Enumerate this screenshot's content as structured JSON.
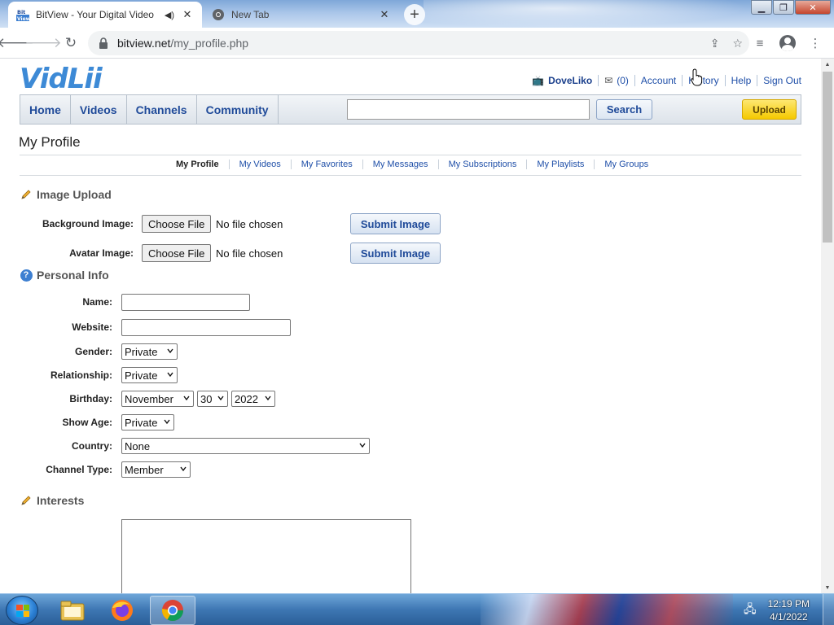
{
  "browser": {
    "tabs": [
      {
        "title": "BitView - Your Digital Video",
        "favicon": "bitview-favicon",
        "favicon_text": "Bit View",
        "active": true
      },
      {
        "title": "New Tab",
        "favicon": "chrome-icon",
        "active": false
      }
    ],
    "url_host": "bitview.net",
    "url_path": "/my_profile.php"
  },
  "site": {
    "logo_text": "VidLii",
    "user": {
      "username": "DoveLiko",
      "messages_count": "(0)",
      "links": [
        "Account",
        "History",
        "Help",
        "Sign Out"
      ]
    },
    "nav": [
      "Home",
      "Videos",
      "Channels",
      "Community"
    ],
    "search_placeholder": "",
    "search_label": "Search",
    "upload_label": "Upload",
    "colors": {
      "link": "#1f4fa8",
      "logo": "#5aa3e0",
      "upload": "#f5c900"
    }
  },
  "page": {
    "title": "My Profile",
    "subnav": [
      "My Profile",
      "My Videos",
      "My Favorites",
      "My Messages",
      "My Subscriptions",
      "My Playlists",
      "My Groups"
    ],
    "image_upload": {
      "heading": "Image Upload",
      "rows": [
        {
          "label": "Background Image:",
          "file_button": "Choose File",
          "file_status": "No file chosen",
          "submit": "Submit Image"
        },
        {
          "label": "Avatar Image:",
          "file_button": "Choose File",
          "file_status": "No file chosen",
          "submit": "Submit Image"
        }
      ]
    },
    "personal_info": {
      "heading": "Personal Info",
      "name_label": "Name:",
      "name_value": "",
      "website_label": "Website:",
      "website_value": "",
      "gender_label": "Gender:",
      "gender_value": "Private",
      "relationship_label": "Relationship:",
      "relationship_value": "Private",
      "birthday_label": "Birthday:",
      "birthday_month": "November",
      "birthday_day": "30",
      "birthday_year": "2022",
      "show_age_label": "Show Age:",
      "show_age_value": "Private",
      "country_label": "Country:",
      "country_value": "None",
      "channel_type_label": "Channel Type:",
      "channel_type_value": "Member"
    },
    "interests": {
      "heading": "Interests",
      "value": ""
    }
  },
  "taskbar": {
    "apps": [
      "windows-explorer-icon",
      "firefox-icon",
      "chrome-icon"
    ],
    "time": "12:19 PM",
    "date": "4/1/2022"
  }
}
